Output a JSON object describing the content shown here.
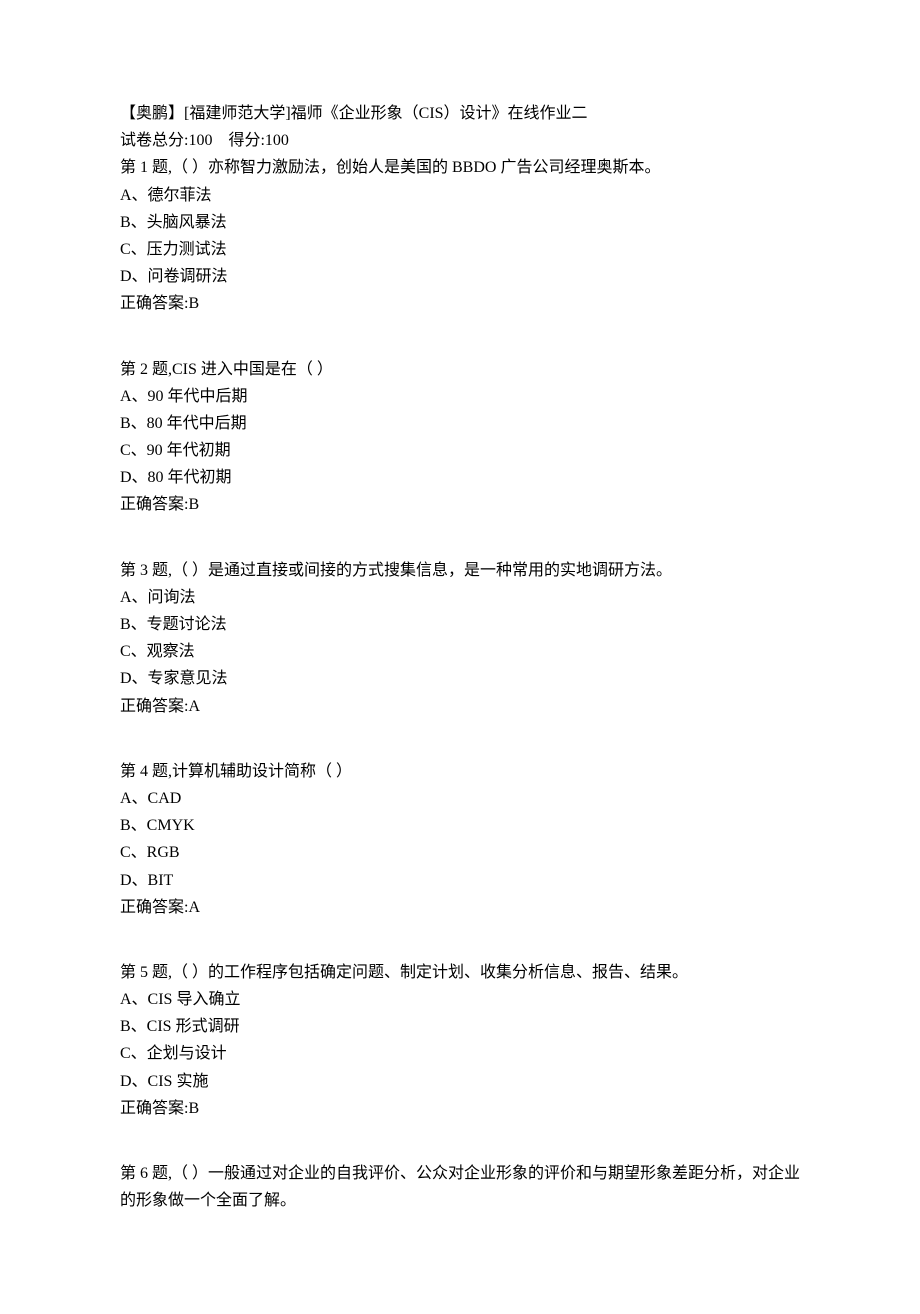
{
  "header": {
    "title": "【奥鹏】[福建师范大学]福师《企业形象（CIS）设计》在线作业二",
    "score_line": "试卷总分:100    得分:100"
  },
  "questions": [
    {
      "stem": "第 1 题,（ ）亦称智力激励法，创始人是美国的 BBDO 广告公司经理奥斯本。",
      "options": [
        "A、德尔菲法",
        "B、头脑风暴法",
        "C、压力测试法",
        "D、问卷调研法"
      ],
      "answer": "正确答案:B"
    },
    {
      "stem": "第 2 题,CIS 进入中国是在（ ）",
      "options": [
        "A、90 年代中后期",
        "B、80 年代中后期",
        "C、90 年代初期",
        "D、80 年代初期"
      ],
      "answer": "正确答案:B"
    },
    {
      "stem": "第 3 题,（ ）是通过直接或间接的方式搜集信息，是一种常用的实地调研方法。",
      "options": [
        "A、问询法",
        "B、专题讨论法",
        "C、观察法",
        "D、专家意见法"
      ],
      "answer": "正确答案:A"
    },
    {
      "stem": "第 4 题,计算机辅助设计简称（ ）",
      "options": [
        "A、CAD",
        "B、CMYK",
        "C、RGB",
        "D、BIT"
      ],
      "answer": "正确答案:A"
    },
    {
      "stem": "第 5 题,（ ）的工作程序包括确定问题、制定计划、收集分析信息、报告、结果。",
      "options": [
        "A、CIS 导入确立",
        "B、CIS 形式调研",
        "C、企划与设计",
        "D、CIS 实施"
      ],
      "answer": "正确答案:B"
    },
    {
      "stem": "第 6 题,（ ）一般通过对企业的自我评价、公众对企业形象的评价和与期望形象差距分析，对企业的形象做一个全面了解。",
      "options": [],
      "answer": ""
    }
  ]
}
